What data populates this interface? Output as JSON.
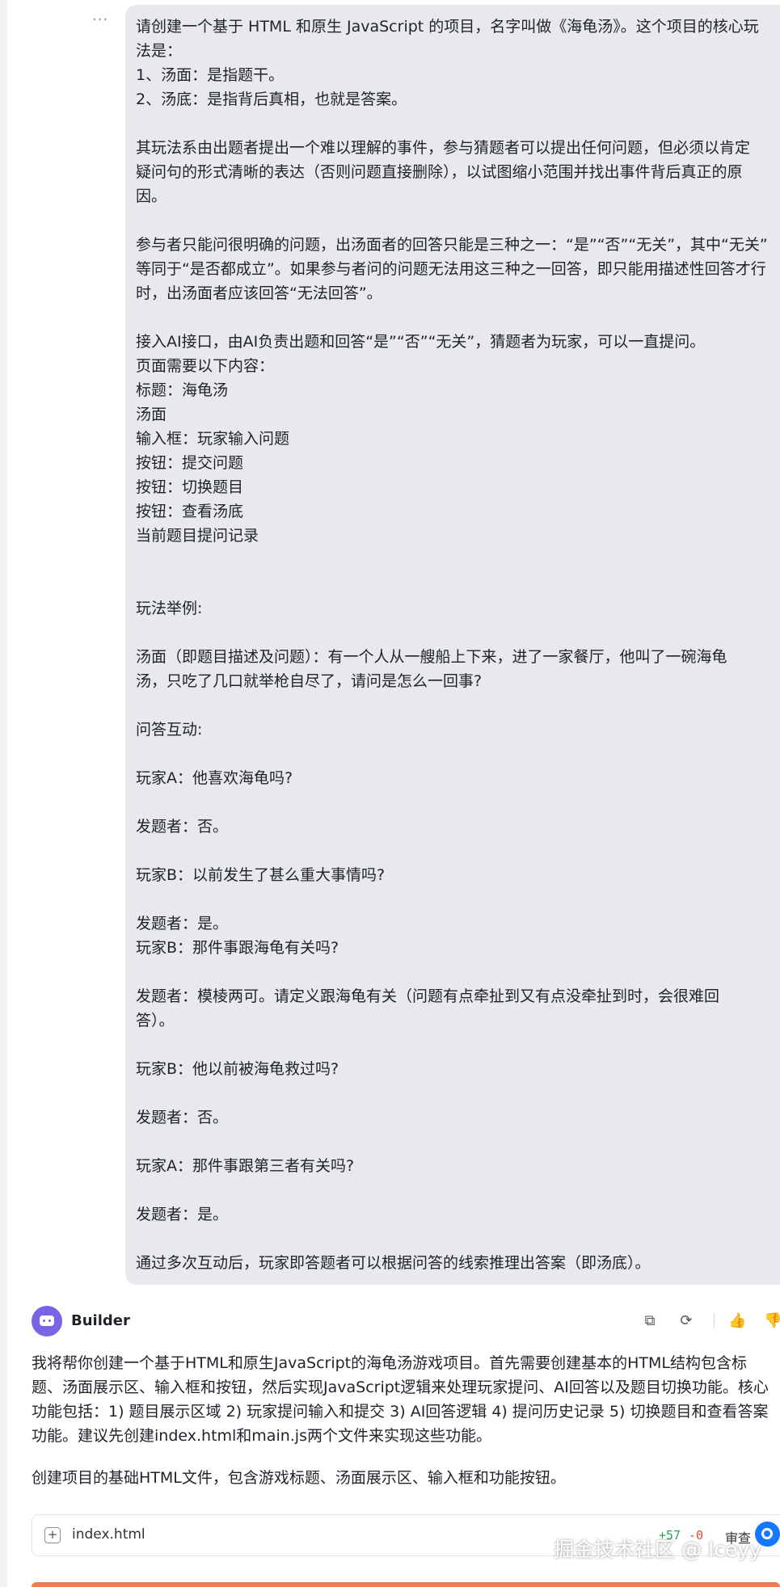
{
  "more_glyph": "···",
  "user_message": {
    "lines": [
      "请创建一个基于 HTML 和原生 JavaScript 的项目，名字叫做《海龟汤》。这个项目的核心玩",
      "法是：",
      "1、汤面：是指题干。",
      "2、汤底：是指背后真相，也就是答案。",
      "",
      "其玩法系由出题者提出一个难以理解的事件，参与猜题者可以提出任何问题，但必须以肯定",
      "疑问句的形式清晰的表达（否则问题直接删除），以试图缩小范围并找出事件背后真正的原",
      "因。",
      "",
      "参与者只能问很明确的问题，出汤面者的回答只能是三种之一：“是”“否”“无关”，其中“无关”",
      "等同于“是否都成立”。如果参与者问的问题无法用这三种之一回答，即只能用描述性回答才行",
      "时，出汤面者应该回答“无法回答”。",
      "",
      "接入AI接口，由AI负责出题和回答“是”“否”“无关”，猜题者为玩家，可以一直提问。",
      "页面需要以下内容：",
      "标题：海龟汤",
      "汤面",
      "输入框：玩家输入问题",
      "按钮：提交问题",
      "按钮：切换题目",
      "按钮：查看汤底",
      "当前题目提问记录",
      "",
      "",
      "玩法举例:",
      "",
      "汤面（即题目描述及问题）：有一个人从一艘船上下来，进了一家餐厅，他叫了一碗海龟",
      "汤，只吃了几口就举枪自尽了，请问是怎么一回事?",
      "",
      "问答互动:",
      "",
      "玩家A：他喜欢海龟吗?",
      "",
      "发题者：否。",
      "",
      "玩家B：以前发生了甚么重大事情吗?",
      "",
      "发题者：是。",
      "玩家B：那件事跟海龟有关吗?",
      "",
      "发题者：模棱两可。请定义跟海龟有关（问题有点牵扯到又有点没牵扯到时，会很难回",
      "答）。",
      "",
      "玩家B：他以前被海龟救过吗?",
      "",
      "发题者：否。",
      "",
      "玩家A：那件事跟第三者有关吗?",
      "",
      "发题者：是。",
      "",
      "通过多次互动后，玩家即答题者可以根据问答的线索推理出答案（即汤底）。"
    ]
  },
  "builder": {
    "name": "Builder",
    "actions": {
      "copy": "⧉",
      "regenerate": "⟳",
      "like": "👍",
      "dislike": "👎"
    },
    "paragraph1": [
      "我将帮你创建一个基于HTML和原生JavaScript的海龟汤游戏项目。首先需要创建基本的HTML结构包含标",
      "题、汤面展示区、输入框和按钮，然后实现JavaScript逻辑来处理玩家提问、AI回答以及题目切换功能。核心",
      "功能包括：1) 题目展示区域 2) 玩家提问输入和提交 3) AI回答逻辑 4) 提问历史记录 5) 切换题目和查看答案",
      "功能。建议先创建index.html和main.js两个文件来实现这些功能。"
    ],
    "paragraph2": "创建项目的基础HTML文件，包含游戏标题、汤面展示区、输入框和功能按钮。"
  },
  "file_card": {
    "plus": "+",
    "filename": "index.html",
    "additions": "+57",
    "deletions": "-0",
    "review_label": "审查"
  },
  "watermark": "掘金技术社区 @ Iceyy",
  "colors": {
    "bubble": "#e8e9ed",
    "avatar": "#7b63e6",
    "diff_add": "#2ca05a",
    "diff_del": "#e0483c",
    "accent": "#1677ff",
    "bottom_bar": "#f07a52"
  }
}
